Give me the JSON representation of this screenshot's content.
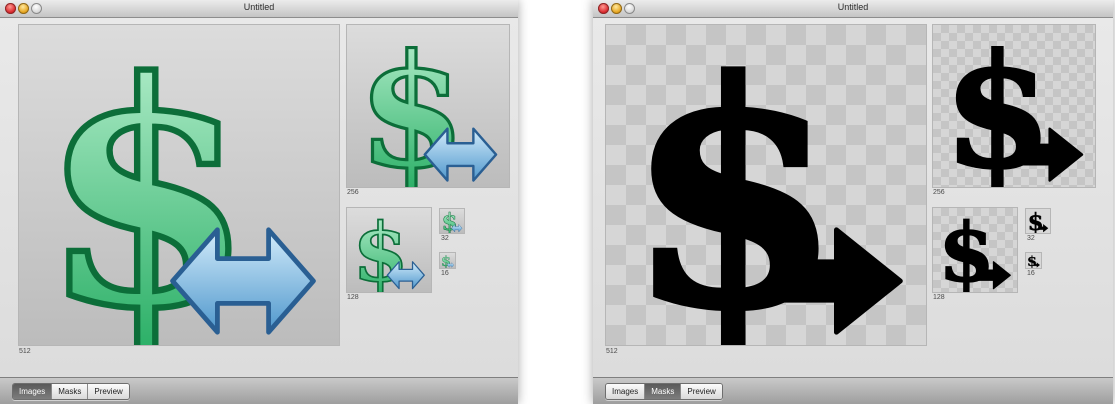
{
  "windows": [
    {
      "title": "Untitled",
      "view": "images",
      "sizes": {
        "s512": "512",
        "s256": "256",
        "s128": "128",
        "s32": "32",
        "s16": "16"
      },
      "tabs": [
        "Images",
        "Masks",
        "Preview"
      ],
      "selected_tab": "Images"
    },
    {
      "title": "Untitled",
      "view": "masks",
      "sizes": {
        "s512": "512",
        "s256": "256",
        "s128": "128",
        "s32": "32",
        "s16": "16"
      },
      "tabs": [
        "Images",
        "Masks",
        "Preview"
      ],
      "selected_tab": "Masks"
    }
  ],
  "icon": {
    "name": "dollar-arrow-icon",
    "glyph": "$"
  },
  "colors": {
    "dollar_green": "#1faa5e",
    "dollar_light": "#bff3d4",
    "arrow_blue": "#4f97cc",
    "mask_black": "#000000"
  }
}
